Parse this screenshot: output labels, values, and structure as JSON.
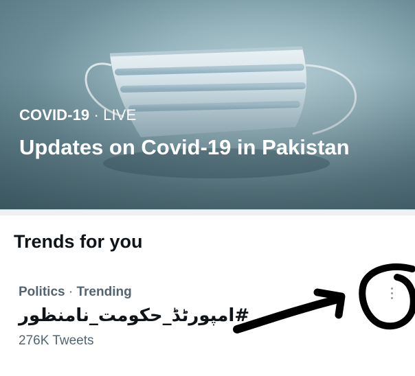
{
  "hero": {
    "category": "COVID-19",
    "separator": "·",
    "status": "LIVE",
    "title": "Updates on Covid-19 in Pakistan"
  },
  "trends": {
    "heading": "Trends for you",
    "items": [
      {
        "topic": "Politics",
        "separator": "·",
        "state": "Trending",
        "name": "#امپورٹڈ_حکومت_نامنظور",
        "count": "276K Tweets",
        "menu_icon": "more-vertical-icon"
      }
    ]
  },
  "annotations": {
    "arrow": "hand-drawn-arrow",
    "circle": "hand-drawn-circle"
  }
}
